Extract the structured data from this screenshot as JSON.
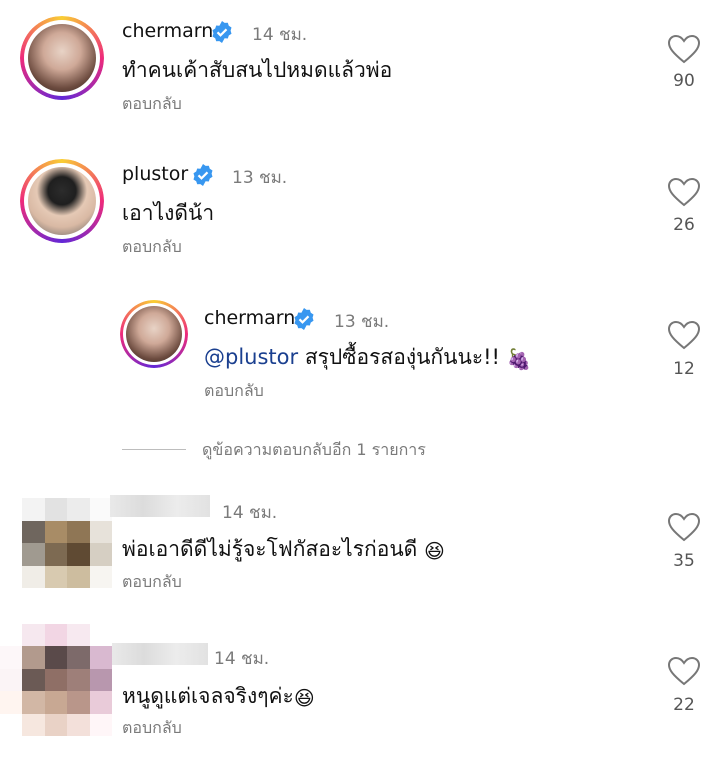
{
  "comments": [
    {
      "username": "chermarn",
      "verified": true,
      "time": "14 ชม.",
      "text": "ทำคนเค้าสับสนไปหมดแล้วพ่อ",
      "reply_label": "ตอบกลับ",
      "likes": "90"
    },
    {
      "username": "plustor",
      "verified": true,
      "time": "13 ชม.",
      "text": "เอาไงดีน้า",
      "reply_label": "ตอบกลับ",
      "likes": "26"
    },
    {
      "username": "chermarn",
      "verified": true,
      "time": "13 ชม.",
      "mention": "@plustor",
      "text": " สรุปซื้อรสองุ่นกันนะ!! ",
      "emoji": "🍇",
      "reply_label": "ตอบกลับ",
      "likes": "12"
    },
    {
      "username": "",
      "verified": false,
      "time": "14 ชม.",
      "text": "พ่อเอาดีดีไม่รู้จะโฟกัสอะไรก่อนดี ",
      "emoji": "😆",
      "reply_label": "ตอบกลับ",
      "likes": "35"
    },
    {
      "username": "",
      "verified": false,
      "time": "14 ชม.",
      "text": "หนูดูแต่เจลจริงๆค่ะ",
      "emoji": "😆",
      "reply_label": "ตอบกลับ",
      "likes": "22"
    }
  ],
  "view_more_replies": "ดูข้อความตอบกลับอีก 1 รายการ",
  "colors": {
    "verified_badge": "#3897f0",
    "mention": "#1a3f8f",
    "muted_text": "#7a7a7a"
  }
}
